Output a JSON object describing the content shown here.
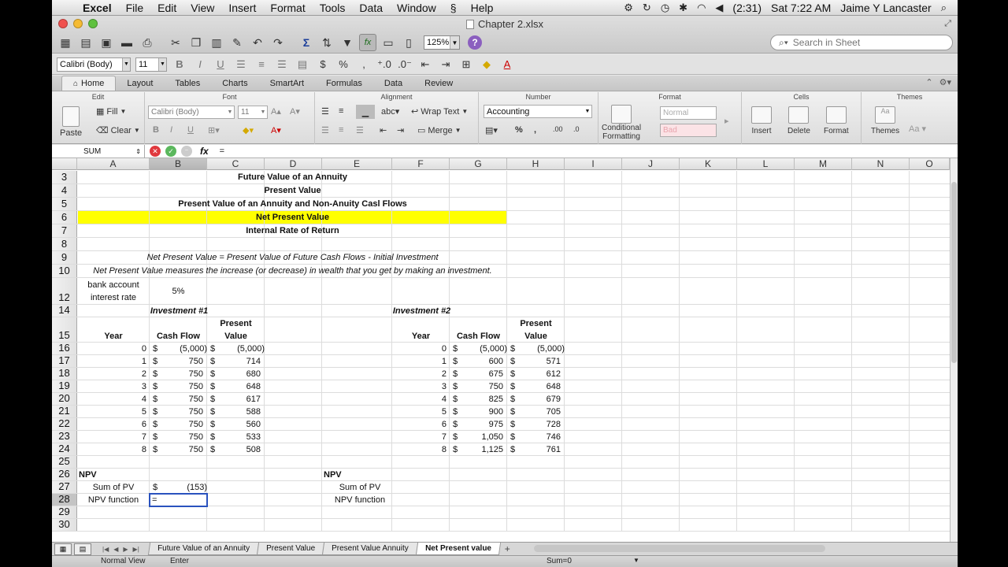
{
  "menubar": {
    "app": "Excel",
    "items": [
      "File",
      "Edit",
      "View",
      "Insert",
      "Format",
      "Tools",
      "Data",
      "Window",
      "Help"
    ],
    "battery": "(2:31)",
    "clock": "Sat 7:22 AM",
    "user": "Jaime Y Lancaster"
  },
  "window": {
    "title": "Chapter 2.xlsx"
  },
  "toolbar": {
    "zoom": "125%",
    "search_placeholder": "Search in Sheet"
  },
  "formatbar": {
    "font": "Calibri (Body)",
    "size": "11"
  },
  "ribbon": {
    "tabs": [
      "Home",
      "Layout",
      "Tables",
      "Charts",
      "SmartArt",
      "Formulas",
      "Data",
      "Review"
    ],
    "groups": {
      "edit": "Edit",
      "font": "Font",
      "alignment": "Alignment",
      "number": "Number",
      "format": "Format",
      "cells": "Cells",
      "themes": "Themes"
    },
    "fill": "Fill",
    "clear": "Clear",
    "paste": "Paste",
    "font_name": "Calibri (Body)",
    "font_size": "11",
    "wrap_text": "Wrap Text",
    "merge": "Merge",
    "number_format": "Accounting",
    "cond_format_1": "Conditional",
    "cond_format_2": "Formatting",
    "style_normal": "Normal",
    "style_bad": "Bad",
    "insert": "Insert",
    "delete": "Delete",
    "format_btn": "Format",
    "themes_btn": "Themes",
    "aa": "Aa"
  },
  "formula_bar": {
    "name_box": "SUM",
    "formula": "="
  },
  "columns": [
    "A",
    "B",
    "C",
    "D",
    "E",
    "F",
    "G",
    "H",
    "I",
    "J",
    "K",
    "L",
    "M",
    "N",
    "O"
  ],
  "rows": [
    "3",
    "4",
    "5",
    "6",
    "7",
    "8",
    "9",
    "10",
    "12",
    "14",
    "15",
    "16",
    "17",
    "18",
    "19",
    "20",
    "21",
    "22",
    "23",
    "24",
    "25",
    "26",
    "27",
    "28",
    "29",
    "30"
  ],
  "sheet": {
    "title1": "Future Value of an Annuity",
    "title2": "Present Value",
    "title3": "Present Value of an Annuity and Non-Anuity Casl Flows",
    "title4": "Net Present Value",
    "title5": "Internal Rate of Return",
    "def1": "Net Present Value = Present Value of Future Cash Flows - Initial Investment",
    "def2": "Net Present Value measures the increase (or decrease) in wealth that you get by making an investment.",
    "rate_label_1": "bank account",
    "rate_label_2": "interest rate",
    "rate_value": "5%",
    "inv1_title": "Investment #1",
    "inv2_title": "Investment #2",
    "h_year": "Year",
    "h_cash": "Cash Flow",
    "h_pv1": "Present",
    "h_pv2": "Value",
    "currency": "$",
    "inv1": {
      "years": [
        "0",
        "1",
        "2",
        "3",
        "4",
        "5",
        "6",
        "7",
        "8"
      ],
      "cash": [
        "(5,000)",
        "750",
        "750",
        "750",
        "750",
        "750",
        "750",
        "750",
        "750"
      ],
      "pv": [
        "(5,000)",
        "714",
        "680",
        "648",
        "617",
        "588",
        "560",
        "533",
        "508"
      ]
    },
    "inv2": {
      "years": [
        "0",
        "1",
        "2",
        "3",
        "4",
        "5",
        "6",
        "7",
        "8"
      ],
      "cash": [
        "(5,000)",
        "600",
        "675",
        "750",
        "825",
        "900",
        "975",
        "1,050",
        "1,125"
      ],
      "pv": [
        "(5,000)",
        "571",
        "612",
        "648",
        "679",
        "705",
        "728",
        "746",
        "761"
      ]
    },
    "npv": "NPV",
    "sum_pv": "Sum of PV",
    "sum_pv_value": "(153)",
    "npv_function": "NPV function",
    "active_entry": "="
  },
  "sheet_tabs": [
    "Future Value of an Annuity",
    "Present Value",
    "Present Value Annuity",
    "Net Present value"
  ],
  "status": {
    "view": "Normal View",
    "mode": "Enter",
    "sum": "Sum=0"
  },
  "colors": {
    "highlight": "#ffff00",
    "selection": "#2a52be"
  }
}
